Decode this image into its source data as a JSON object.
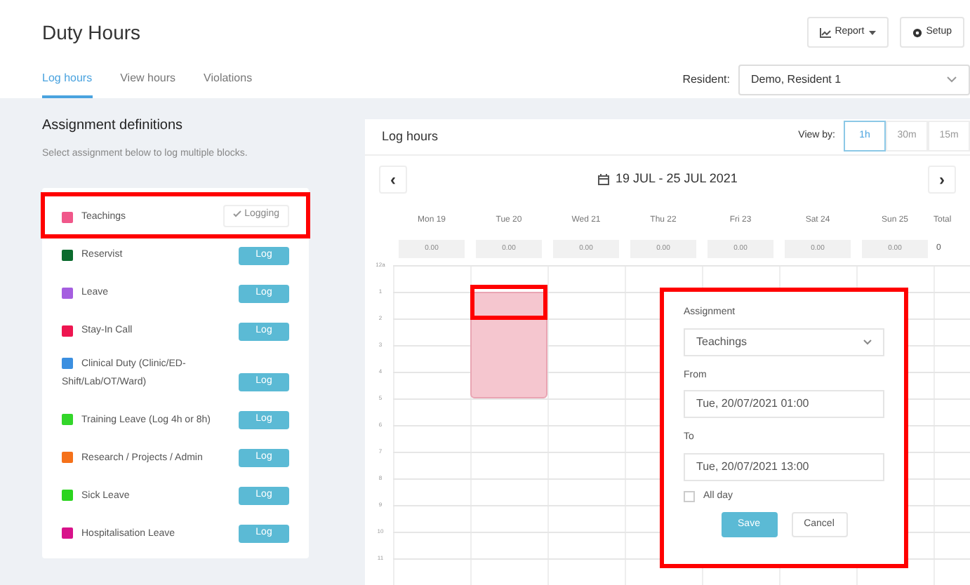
{
  "header": {
    "title": "Duty Hours",
    "buttons": [
      {
        "kind": "report",
        "label": "Report"
      },
      {
        "kind": "setup",
        "label": "Setup"
      }
    ]
  },
  "tabs": [
    {
      "label": "Log hours",
      "selected": true
    },
    {
      "label": "View hours",
      "selected": false
    },
    {
      "label": "Violations",
      "selected": false
    }
  ],
  "resident": {
    "label": "Resident:",
    "value": "Demo, Resident 1"
  },
  "assignments": {
    "title": "Assignment definitions",
    "subtitle": "Select assignment below to log multiple blocks.",
    "items": [
      {
        "name": "Teachings",
        "color": "#f0578a",
        "logging": true,
        "button": "Logging",
        "highlighted": true
      },
      {
        "name": "Reservist",
        "color": "#0b6b2e",
        "logging": false,
        "button": "Log",
        "highlighted": false
      },
      {
        "name": "Leave",
        "color": "#a55ee0",
        "logging": false,
        "button": "Log",
        "highlighted": false
      },
      {
        "name": "Stay-In Call",
        "color": "#ee1650",
        "logging": false,
        "button": "Log",
        "highlighted": false
      },
      {
        "name": "Clinical Duty (Clinic/ED-Shift/Lab/OT/Ward)",
        "color": "#3b8fe0",
        "logging": false,
        "button": "Log",
        "highlighted": false
      },
      {
        "name": "Training Leave (Log 4h or 8h)",
        "color": "#33d62a",
        "logging": false,
        "button": "Log",
        "highlighted": false
      },
      {
        "name": "Research / Projects / Admin",
        "color": "#f5711a",
        "logging": false,
        "button": "Log",
        "highlighted": false
      },
      {
        "name": "Sick Leave",
        "color": "#2bd41e",
        "logging": false,
        "button": "Log",
        "highlighted": false
      },
      {
        "name": "Hospitalisation Leave",
        "color": "#d8128a",
        "logging": false,
        "button": "Log",
        "highlighted": false
      }
    ]
  },
  "log_hours": {
    "title": "Log hours",
    "view_by_label": "View by:",
    "view_by": [
      {
        "label": "1h",
        "selected": true
      },
      {
        "label": "30m",
        "selected": false
      },
      {
        "label": "15m",
        "selected": false
      }
    ],
    "prev": "‹",
    "next": "›",
    "week": "19 JUL - 25 JUL 2021",
    "days": [
      {
        "label": "Mon 19",
        "total": "0.00",
        "has_block": false,
        "block_highlighted": false
      },
      {
        "label": "Tue 20",
        "total": "0.00",
        "has_block": true,
        "block_highlighted": true
      },
      {
        "label": "Wed 21",
        "total": "0.00",
        "has_block": false,
        "block_highlighted": false
      },
      {
        "label": "Thu 22",
        "total": "0.00",
        "has_block": false,
        "block_highlighted": false
      },
      {
        "label": "Fri 23",
        "total": "0.00",
        "has_block": false,
        "block_highlighted": false
      },
      {
        "label": "Sat 24",
        "total": "0.00",
        "has_block": false,
        "block_highlighted": false
      },
      {
        "label": "Sun 25",
        "total": "0.00",
        "has_block": false,
        "block_highlighted": false
      }
    ],
    "total_label": "Total",
    "total_value": "0",
    "hours": [
      "12a",
      "1",
      "2",
      "3",
      "4",
      "5",
      "6",
      "7",
      "8",
      "9",
      "10",
      "11"
    ],
    "popup": {
      "assignment_label": "Assignment",
      "assignment": "Teachings",
      "from_label": "From",
      "from": "Tue, 20/07/2021 01:00",
      "to_label": "To",
      "to": "Tue, 20/07/2021 13:00",
      "all_day_label": "All day",
      "all_day": false,
      "save": "Save",
      "cancel": "Cancel",
      "highlighted": true
    }
  }
}
